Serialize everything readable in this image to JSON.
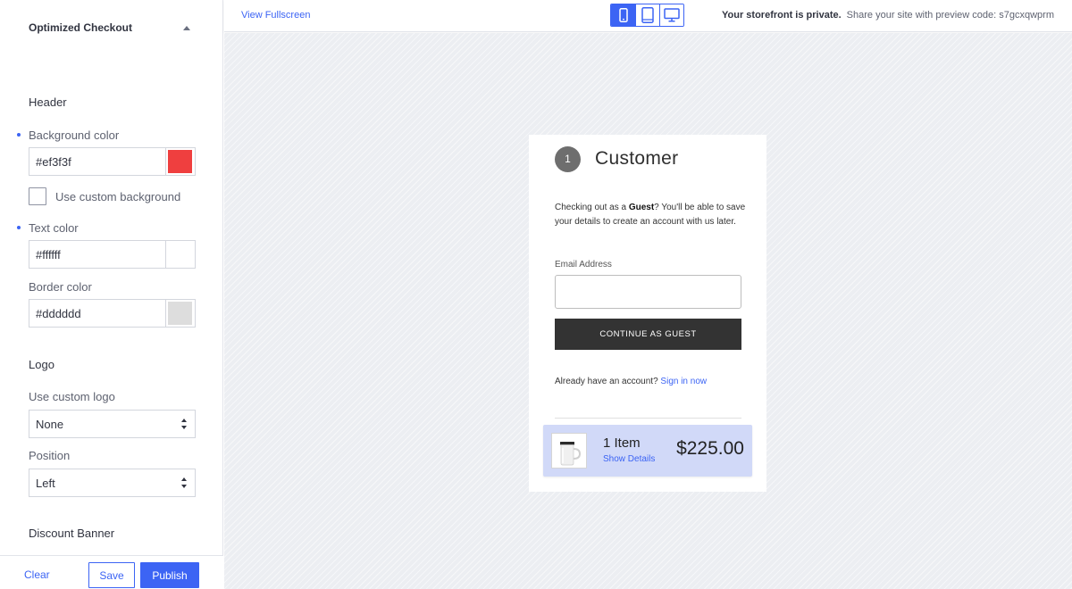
{
  "sidebar": {
    "title": "Optimized Checkout",
    "header_section": "Header",
    "background_color": {
      "label": "Background color",
      "value": "#ef3f3f",
      "swatch": "#ef3f3f"
    },
    "custom_background_label": "Use custom background",
    "text_color": {
      "label": "Text color",
      "value": "#ffffff",
      "swatch": "#ffffff"
    },
    "border_color": {
      "label": "Border color",
      "value": "#dddddd",
      "swatch": "#dddddd"
    },
    "logo_section": "Logo",
    "custom_logo": {
      "label": "Use custom logo",
      "value": "None"
    },
    "position": {
      "label": "Position",
      "value": "Left"
    },
    "discount_section": "Discount Banner",
    "footer": {
      "clear": "Clear",
      "save": "Save",
      "publish": "Publish"
    }
  },
  "topbar": {
    "view_fullscreen": "View Fullscreen",
    "devices": [
      "mobile-icon",
      "tablet-icon",
      "desktop-icon"
    ],
    "active_device": "mobile",
    "private_bold": "Your storefront is private.",
    "private_text": "Share your site with preview code: s7gcxqwprm"
  },
  "checkout": {
    "step_number": "1",
    "step_title": "Customer",
    "guest_pre": "Checking out as a ",
    "guest_bold": "Guest",
    "guest_post": "? You'll be able to save your details to create an account with us later.",
    "email_label": "Email Address",
    "email_value": "",
    "continue_label": "CONTINUE AS GUEST",
    "account_prompt": "Already have an account?",
    "signin_link": "Sign in now",
    "cart": {
      "count": "1 Item",
      "details_link": "Show Details",
      "total": "$225.00"
    }
  },
  "colors": {
    "accent": "#3c64f4",
    "button_dark": "#333333",
    "cart_bg": "#d1d9f8"
  }
}
